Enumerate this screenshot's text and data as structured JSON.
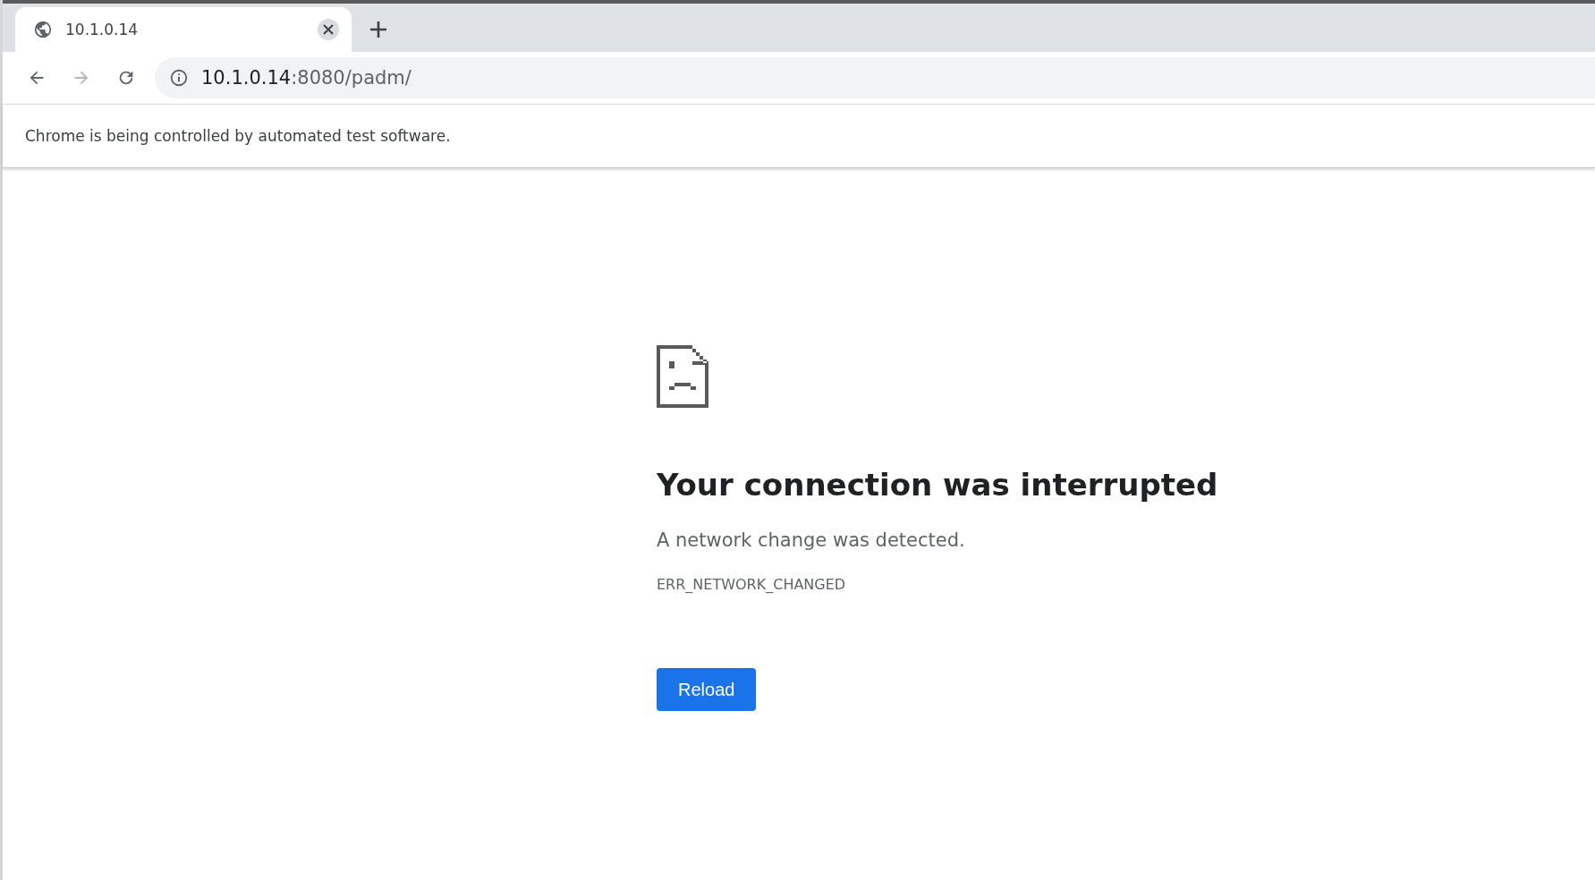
{
  "tabs": [
    {
      "title": "10.1.0.14",
      "selected": true
    }
  ],
  "nav_buttons": [
    {
      "kind": "back",
      "disabled": false
    },
    {
      "kind": "forward",
      "disabled": true
    },
    {
      "kind": "reload",
      "disabled": false
    }
  ],
  "address_bar": {
    "host": "10.1.0.14",
    "path": ":8080/padm/"
  },
  "infobar": {
    "text": "Chrome is being controlled by automated test software."
  },
  "error": {
    "heading": "Your connection was interrupted",
    "message": "A network change was detected.",
    "code": "ERR_NETWORK_CHANGED",
    "button": "Reload"
  }
}
